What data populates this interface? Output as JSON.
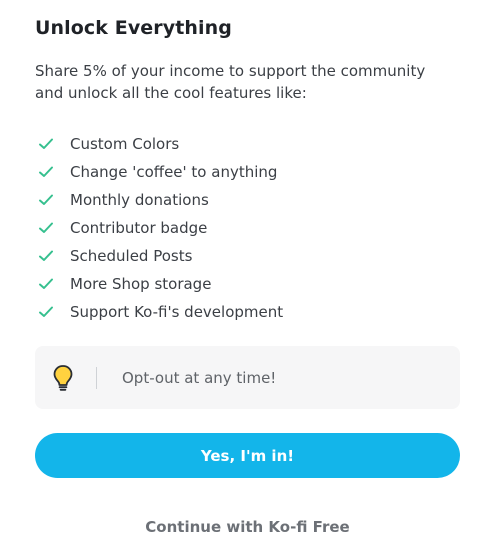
{
  "dialog": {
    "title": "Unlock Everything",
    "subtitle": "Share 5% of your income to support the community and unlock all the cool features like:",
    "features": [
      {
        "label": "Custom Colors",
        "icon": "check-icon"
      },
      {
        "label": "Change 'coffee' to anything",
        "icon": "check-icon"
      },
      {
        "label": "Monthly donations",
        "icon": "check-icon"
      },
      {
        "label": "Contributor badge",
        "icon": "check-icon"
      },
      {
        "label": "Scheduled Posts",
        "icon": "check-icon"
      },
      {
        "label": "More Shop storage",
        "icon": "check-icon"
      },
      {
        "label": "Support Ko-fi's development",
        "icon": "check-icon"
      }
    ],
    "optout": {
      "icon": "lightbulb-icon",
      "text": "Opt-out at any time!"
    },
    "primary_button": "Yes, I'm in!",
    "secondary_link": "Continue with Ko-fi Free"
  },
  "colors": {
    "accent": "#13b5ea",
    "check": "#36c08f",
    "bulb_fill": "#ffd23f"
  }
}
